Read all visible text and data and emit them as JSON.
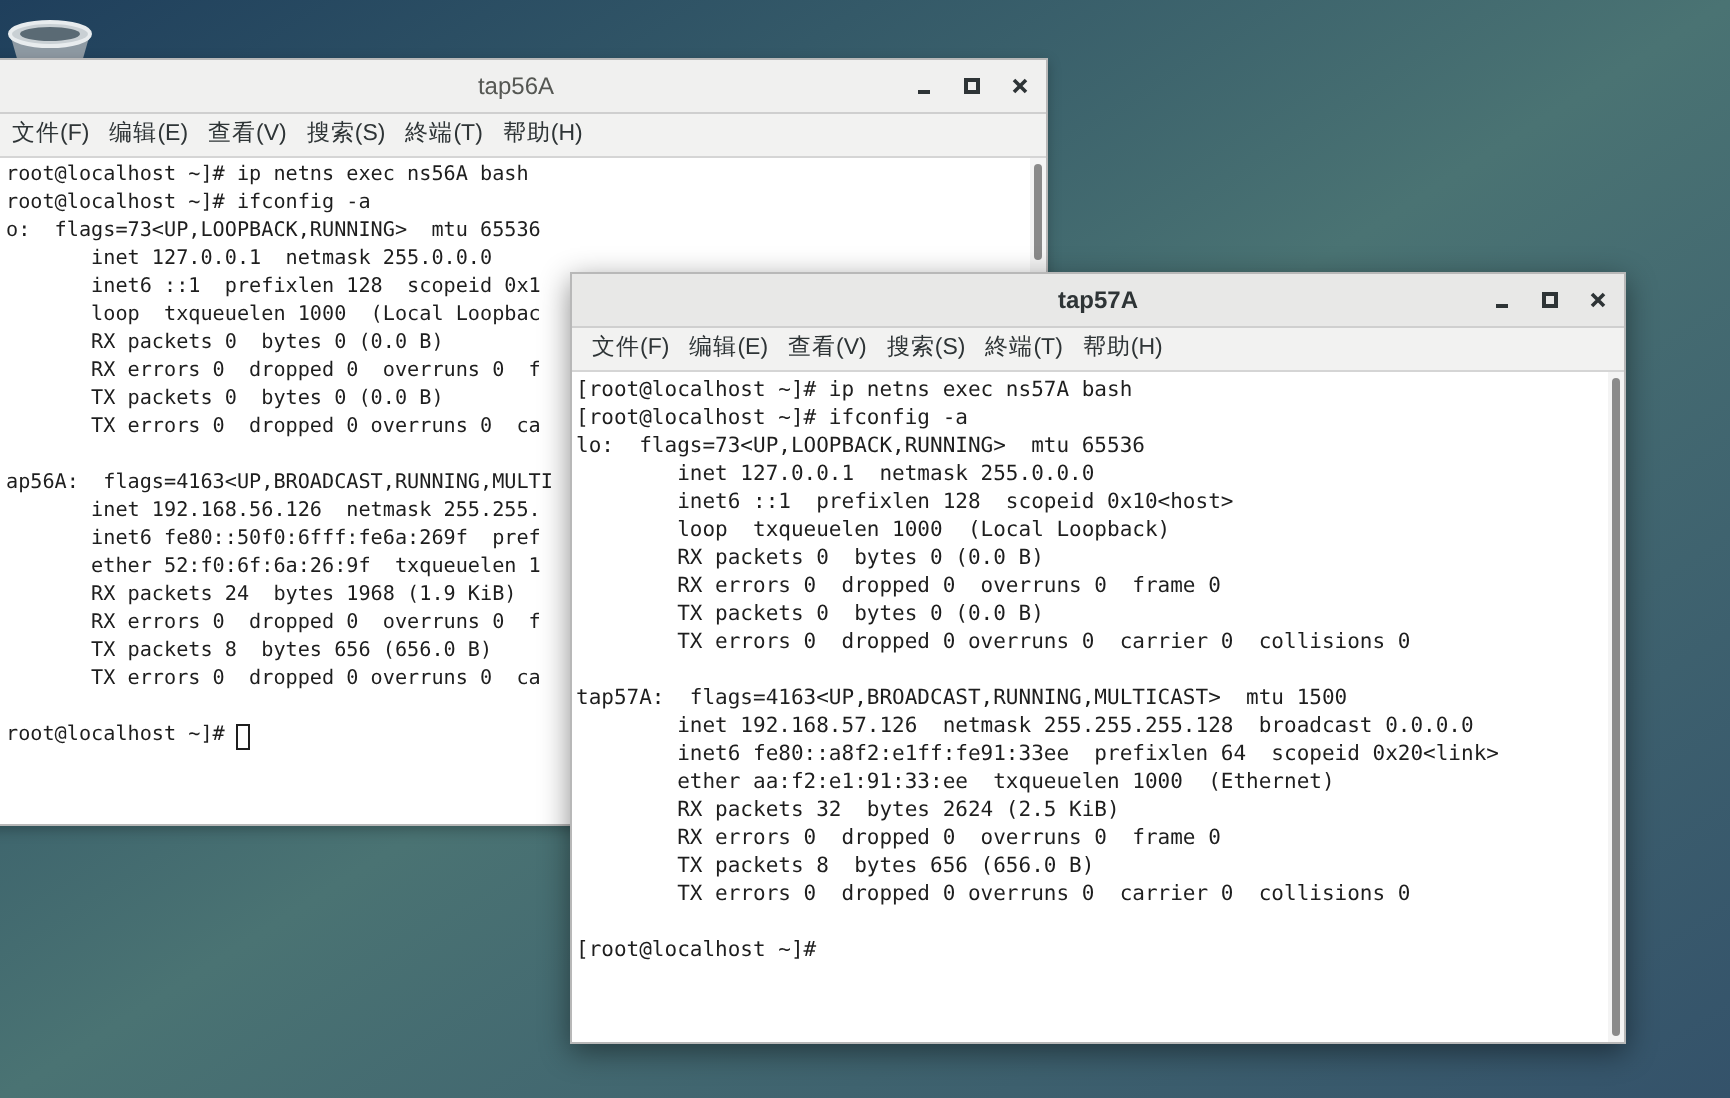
{
  "windows": [
    {
      "title": "tap56A",
      "focused": false,
      "cursor_visible": true,
      "menu": [
        "文件(F)",
        "编辑(E)",
        "查看(V)",
        "搜索(S)",
        "終端(T)",
        "帮助(H)"
      ],
      "blocks": [
        [
          "root@localhost ~]# ip netns exec ns56A bash",
          "root@localhost ~]# ifconfig -a",
          "o:  flags=73<UP,LOOPBACK,RUNNING>  mtu 65536",
          "       inet 127.0.0.1  netmask 255.0.0.0",
          "       inet6 ::1  prefixlen 128  scopeid 0x1",
          "       loop  txqueuelen 1000  (Local Loopbac",
          "       RX packets 0  bytes 0 (0.0 B)",
          "       RX errors 0  dropped 0  overruns 0  f",
          "       TX packets 0  bytes 0 (0.0 B)",
          "       TX errors 0  dropped 0 overruns 0  ca"
        ],
        [
          "ap56A:  flags=4163<UP,BROADCAST,RUNNING,MULTI",
          "       inet 192.168.56.126  netmask 255.255.",
          "       inet6 fe80::50f0:6fff:fe6a:269f  pref",
          "       ether 52:f0:6f:6a:26:9f  txqueuelen 1",
          "       RX packets 24  bytes 1968 (1.9 KiB)",
          "       RX errors 0  dropped 0  overruns 0  f",
          "       TX packets 8  bytes 656 (656.0 B)",
          "       TX errors 0  dropped 0 overruns 0  ca"
        ],
        [
          "root@localhost ~]# "
        ]
      ]
    },
    {
      "title": "tap57A",
      "focused": true,
      "cursor_visible": false,
      "menu": [
        "文件(F)",
        "编辑(E)",
        "查看(V)",
        "搜索(S)",
        "終端(T)",
        "帮助(H)"
      ],
      "blocks": [
        [
          "[root@localhost ~]# ip netns exec ns57A bash",
          "[root@localhost ~]# ifconfig -a",
          "lo:  flags=73<UP,LOOPBACK,RUNNING>  mtu 65536",
          "        inet 127.0.0.1  netmask 255.0.0.0",
          "        inet6 ::1  prefixlen 128  scopeid 0x10<host>",
          "        loop  txqueuelen 1000  (Local Loopback)",
          "        RX packets 0  bytes 0 (0.0 B)",
          "        RX errors 0  dropped 0  overruns 0  frame 0",
          "        TX packets 0  bytes 0 (0.0 B)",
          "        TX errors 0  dropped 0 overruns 0  carrier 0  collisions 0"
        ],
        [
          "tap57A:  flags=4163<UP,BROADCAST,RUNNING,MULTICAST>  mtu 1500",
          "        inet 192.168.57.126  netmask 255.255.255.128  broadcast 0.0.0.0",
          "        inet6 fe80::a8f2:e1ff:fe91:33ee  prefixlen 64  scopeid 0x20<link>",
          "        ether aa:f2:e1:91:33:ee  txqueuelen 1000  (Ethernet)",
          "        RX packets 32  bytes 2624 (2.5 KiB)",
          "        RX errors 0  dropped 0  overruns 0  frame 0",
          "        TX packets 8  bytes 656 (656.0 B)",
          "        TX errors 0  dropped 0 overruns 0  carrier 0  collisions 0"
        ],
        [
          "[root@localhost ~]# "
        ]
      ]
    }
  ]
}
